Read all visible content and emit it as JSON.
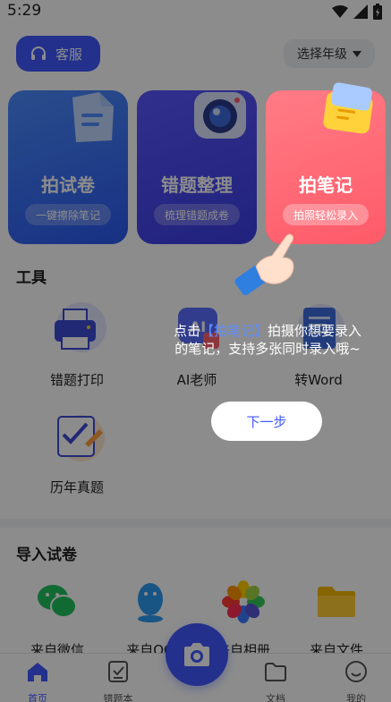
{
  "status_bar": {
    "time": "5:29"
  },
  "header": {
    "service_label": "客服",
    "grade_label": "选择年级"
  },
  "cards": [
    {
      "title": "拍试卷",
      "subtitle": "一键擦除笔记"
    },
    {
      "title": "错题整理",
      "subtitle": "梳理错题成卷"
    },
    {
      "title": "拍笔记",
      "subtitle": "拍照轻松录入"
    }
  ],
  "tools": {
    "title": "工具",
    "items": [
      {
        "label": "错题打印",
        "icon": "printer-icon"
      },
      {
        "label": "AI老师",
        "icon": "ai-teacher-icon"
      },
      {
        "label": "转Word",
        "icon": "word-doc-icon"
      },
      {
        "label": "历年真题",
        "icon": "exam-paper-icon"
      }
    ]
  },
  "import": {
    "title": "导入试卷",
    "items": [
      {
        "label": "来自微信",
        "icon": "wechat-icon"
      },
      {
        "label": "来自QQ",
        "icon": "qq-icon"
      },
      {
        "label": "来自相册",
        "icon": "photos-icon"
      },
      {
        "label": "来自文件",
        "icon": "folder-icon"
      }
    ]
  },
  "tabs": [
    {
      "label": "首页",
      "icon": "home-icon",
      "active": true
    },
    {
      "label": "错题本",
      "icon": "checklist-icon",
      "active": false
    },
    {
      "label": "文档",
      "icon": "folder-icon",
      "active": false
    },
    {
      "label": "我的",
      "icon": "profile-icon",
      "active": false
    }
  ],
  "guide": {
    "prefix": "点击",
    "highlight": "【拍笔记】",
    "suffix": "拍摄你想要录入的笔记，支持多张同时录入哦~",
    "next_label": "下一步"
  },
  "colors": {
    "accent": "#4058ff",
    "note_card": "#ff6270",
    "highlight_text": "#5e8cff"
  }
}
